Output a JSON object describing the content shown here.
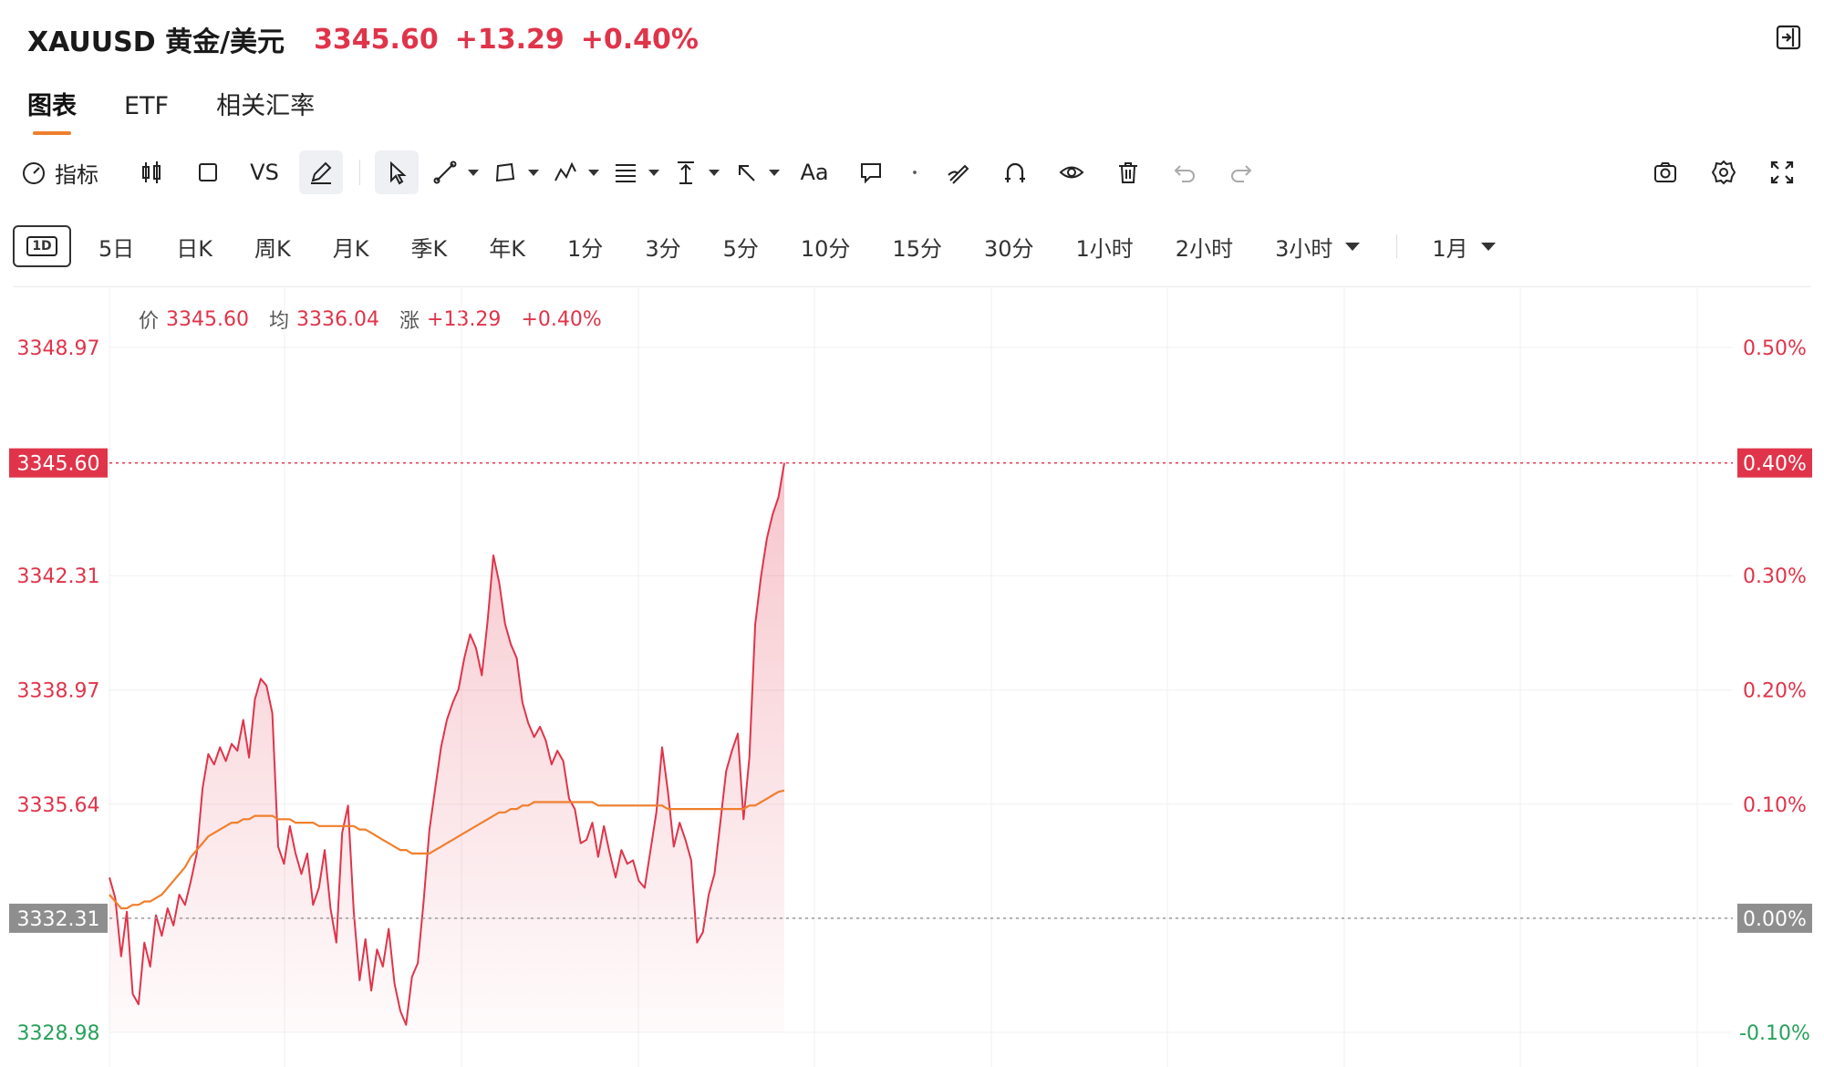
{
  "header": {
    "symbol": "XAUUSD 黄金/美元",
    "price": "3345.60",
    "change": "+13.29",
    "change_pct": "+0.40%"
  },
  "tabs": [
    {
      "label": "图表",
      "active": true
    },
    {
      "label": "ETF",
      "active": false
    },
    {
      "label": "相关汇率",
      "active": false
    }
  ],
  "toolbar": {
    "indicator_label": "指标",
    "vs_label": "VS",
    "text_label": "Aa",
    "icons": [
      "gauge-icon",
      "candlestick-icon",
      "square-icon",
      "pen-icon",
      "cursor-icon",
      "trend-line-icon",
      "shape-icon",
      "pattern-icon",
      "fib-icon",
      "measure-icon",
      "arrow-icon",
      "text-icon",
      "comment-icon",
      "dot-icon",
      "brush-icon",
      "magnet-icon",
      "eye-icon",
      "trash-icon",
      "undo-icon",
      "redo-icon",
      "camera-icon",
      "gear-icon",
      "fullscreen-icon"
    ]
  },
  "periods": {
    "badge": "1D",
    "items": [
      "5日",
      "日K",
      "周K",
      "月K",
      "季K",
      "年K",
      "1分",
      "3分",
      "5分",
      "10分",
      "15分",
      "30分",
      "1小时",
      "2小时",
      "3小时"
    ],
    "range": "1月"
  },
  "legend": {
    "price_key": "价",
    "price": "3345.60",
    "avg_key": "均",
    "avg": "3336.04",
    "chg_key": "涨",
    "chg": "+13.29",
    "chg_pct": "+0.40%"
  },
  "colors": {
    "up": "#e0344a",
    "down": "#27a15b",
    "avg_line": "#f07f2d",
    "last_badge": "#e0344a",
    "base_badge": "#8e8e8e"
  },
  "chart_data": {
    "type": "line",
    "ylabels_left": [
      "3348.97",
      "3345.60",
      "3342.31",
      "3338.97",
      "3335.64",
      "3332.31",
      "3328.98"
    ],
    "ylabels_right": [
      "0.50%",
      "0.40%",
      "0.30%",
      "0.20%",
      "0.10%",
      "0.00%",
      "-0.10%"
    ],
    "ylim": [
      3328.98,
      3348.97
    ],
    "last_price": "3345.60",
    "last_pct": "0.40%",
    "base_price": "3332.31",
    "base_pct": "0.00%",
    "series": [
      {
        "values": [
          3333.5,
          3332.9,
          3331.2,
          3332.5,
          3330.1,
          3329.8,
          3331.6,
          3330.9,
          3332.4,
          3331.8,
          3332.6,
          3332.1,
          3333.0,
          3332.7,
          3333.4,
          3334.2,
          3336.1,
          3337.1,
          3336.8,
          3337.3,
          3336.9,
          3337.4,
          3337.2,
          3338.1,
          3337.0,
          3338.7,
          3339.3,
          3339.1,
          3338.3,
          3334.4,
          3333.9,
          3335.0,
          3334.2,
          3333.6,
          3334.2,
          3332.7,
          3333.2,
          3334.3,
          3332.6,
          3331.6,
          3334.8,
          3335.6,
          3332.5,
          3330.5,
          3331.7,
          3330.2,
          3331.4,
          3330.9,
          3332.0,
          3330.4,
          3329.6,
          3329.2,
          3330.6,
          3331.0,
          3332.8,
          3334.9,
          3336.1,
          3337.3,
          3338.1,
          3338.6,
          3339.0,
          3339.9,
          3340.6,
          3340.2,
          3339.4,
          3341.0,
          3342.9,
          3342.1,
          3340.9,
          3340.3,
          3339.9,
          3338.6,
          3338.0,
          3337.6,
          3337.9,
          3337.5,
          3336.8,
          3337.2,
          3336.9,
          3335.8,
          3335.5,
          3334.5,
          3334.6,
          3335.1,
          3334.1,
          3335.0,
          3334.2,
          3333.5,
          3334.3,
          3333.9,
          3334.0,
          3333.4,
          3333.2,
          3334.3,
          3335.4,
          3337.3,
          3336.0,
          3334.4,
          3335.1,
          3334.6,
          3334.0,
          3331.6,
          3331.9,
          3333.0,
          3333.6,
          3335.1,
          3336.6,
          3337.2,
          3337.7,
          3335.2,
          3337.0,
          3340.9,
          3342.3,
          3343.4,
          3344.1,
          3344.6,
          3345.6
        ]
      },
      {
        "values": [
          3333.0,
          3332.8,
          3332.6,
          3332.6,
          3332.7,
          3332.7,
          3332.8,
          3332.8,
          3332.9,
          3333.0,
          3333.2,
          3333.4,
          3333.6,
          3333.8,
          3334.1,
          3334.3,
          3334.5,
          3334.7,
          3334.8,
          3334.9,
          3335.0,
          3335.1,
          3335.1,
          3335.2,
          3335.2,
          3335.3,
          3335.3,
          3335.3,
          3335.3,
          3335.2,
          3335.2,
          3335.2,
          3335.1,
          3335.1,
          3335.1,
          3335.1,
          3335.0,
          3335.0,
          3335.0,
          3335.0,
          3335.0,
          3335.0,
          3335.0,
          3334.9,
          3334.9,
          3334.8,
          3334.7,
          3334.6,
          3334.5,
          3334.4,
          3334.3,
          3334.3,
          3334.2,
          3334.2,
          3334.2,
          3334.2,
          3334.3,
          3334.4,
          3334.5,
          3334.6,
          3334.7,
          3334.8,
          3334.9,
          3335.0,
          3335.1,
          3335.2,
          3335.3,
          3335.4,
          3335.4,
          3335.5,
          3335.5,
          3335.6,
          3335.6,
          3335.7,
          3335.7,
          3335.7,
          3335.7,
          3335.7,
          3335.7,
          3335.7,
          3335.7,
          3335.7,
          3335.7,
          3335.7,
          3335.6,
          3335.6,
          3335.6,
          3335.6,
          3335.6,
          3335.6,
          3335.6,
          3335.6,
          3335.6,
          3335.6,
          3335.6,
          3335.6,
          3335.5,
          3335.5,
          3335.5,
          3335.5,
          3335.5,
          3335.5,
          3335.5,
          3335.5,
          3335.5,
          3335.5,
          3335.5,
          3335.5,
          3335.5,
          3335.5,
          3335.6,
          3335.6,
          3335.7,
          3335.8,
          3335.9,
          3336.0,
          3336.04
        ]
      }
    ]
  }
}
